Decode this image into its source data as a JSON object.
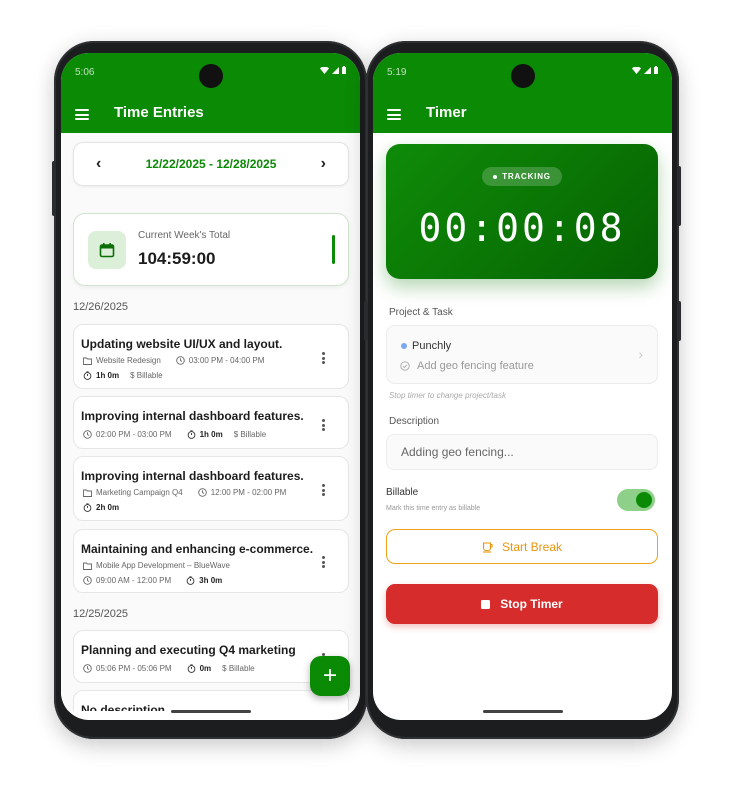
{
  "colors": {
    "primary": "#0b8a05",
    "break_accent": "#f0a21a",
    "stop": "#d62c2c"
  },
  "left_phone": {
    "status_time": "5:06",
    "title": "Time Entries",
    "date_range": "12/22/2025 - 12/28/2025",
    "week_total": {
      "label": "Current Week's Total",
      "value": "104:59:00"
    },
    "groups": [
      {
        "date": "12/26/2025",
        "entries": [
          {
            "title": "Updating website UI/UX and layout.",
            "project": "Website Redesign",
            "time_range": "03:00 PM - 04:00 PM",
            "duration": "1h 0m",
            "billable": "$ Billable"
          },
          {
            "title": "Improving internal dashboard features.",
            "time_range": "02:00 PM - 03:00 PM",
            "duration": "1h 0m",
            "billable": "$ Billable"
          },
          {
            "title": "Improving internal dashboard features.",
            "project": "Marketing Campaign Q4",
            "time_range": "12:00 PM - 02:00 PM",
            "duration": "2h 0m"
          },
          {
            "title": "Maintaining and enhancing e-commerce.",
            "project": "Mobile App Development – BlueWave",
            "time_range": "09:00 AM - 12:00 PM",
            "duration": "3h 0m"
          }
        ]
      },
      {
        "date": "12/25/2025",
        "entries": [
          {
            "title": "Planning and executing Q4 marketing",
            "time_range": "05:06 PM - 05:06 PM",
            "duration": "0m",
            "billable": "$ Billable"
          },
          {
            "title": "No description"
          }
        ]
      }
    ],
    "fab_label": "+"
  },
  "right_phone": {
    "status_time": "5:19",
    "title": "Timer",
    "status_badge": "TRACKING",
    "timer": "00:00:08",
    "project_task_label": "Project & Task",
    "project": "Punchly",
    "task": "Add geo fencing feature",
    "hint": "Stop timer to change project/task",
    "description_label": "Description",
    "description_value": "Adding geo fencing...",
    "billable_label": "Billable",
    "billable_sub": "Mark this time entry as billable",
    "billable_on": true,
    "start_break": "Start Break",
    "stop_timer": "Stop Timer"
  }
}
